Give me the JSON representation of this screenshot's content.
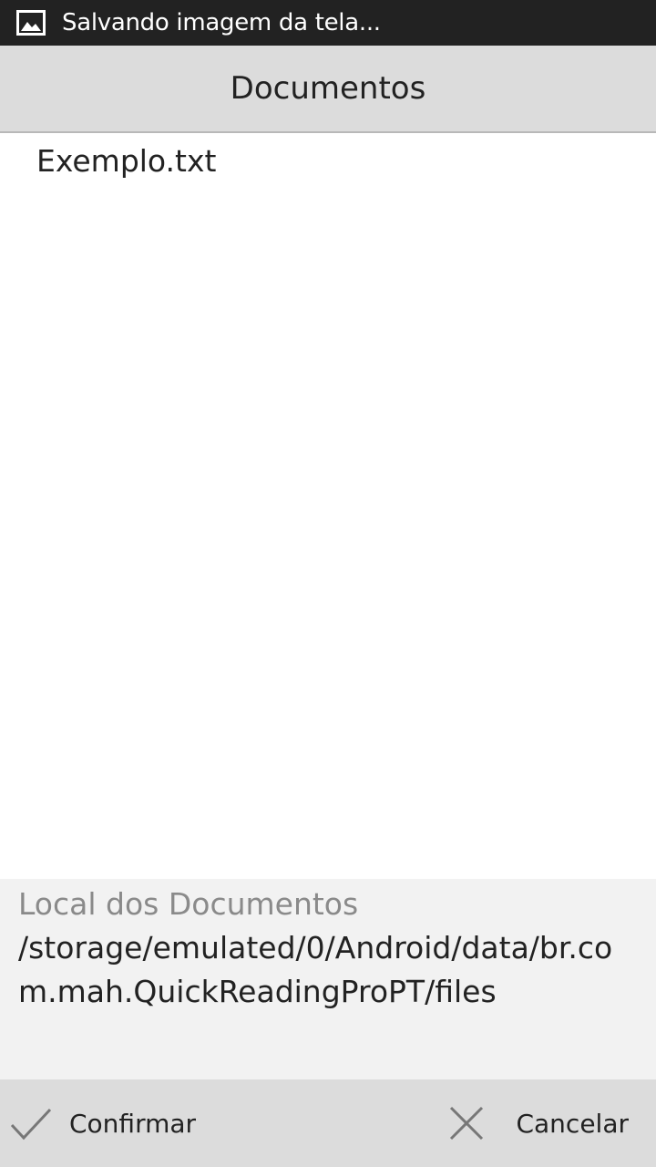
{
  "status_bar": {
    "icon": "image-icon",
    "text": "Salvando imagem da tela..."
  },
  "dialog": {
    "title": "Documentos",
    "files": [
      "Exemplo.txt"
    ],
    "location_label": "Local dos Documentos",
    "location_path": "/storage/emulated/0/Android/data/br.com.mah.QuickReadingProPT/files"
  },
  "buttons": {
    "confirm": {
      "label": "Confirmar",
      "icon": "check-icon"
    },
    "cancel": {
      "label": "Cancelar",
      "icon": "close-icon"
    }
  }
}
